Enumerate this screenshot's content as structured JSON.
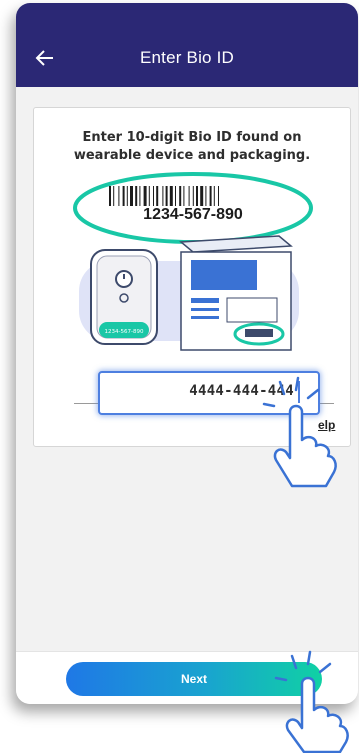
{
  "header": {
    "title": "Enter Bio ID"
  },
  "card": {
    "instruction": "Enter 10-digit Bio ID found on wearable device and packaging.",
    "barcode_number": "1234-567-890",
    "device_label": "1234-567-890",
    "field_value": "4444-444-444",
    "help_label": "elp"
  },
  "footer": {
    "next_label": "Next"
  },
  "colors": {
    "header": "#2b2875",
    "accent_teal": "#19c7a6",
    "input_border": "#4d7fe0"
  }
}
